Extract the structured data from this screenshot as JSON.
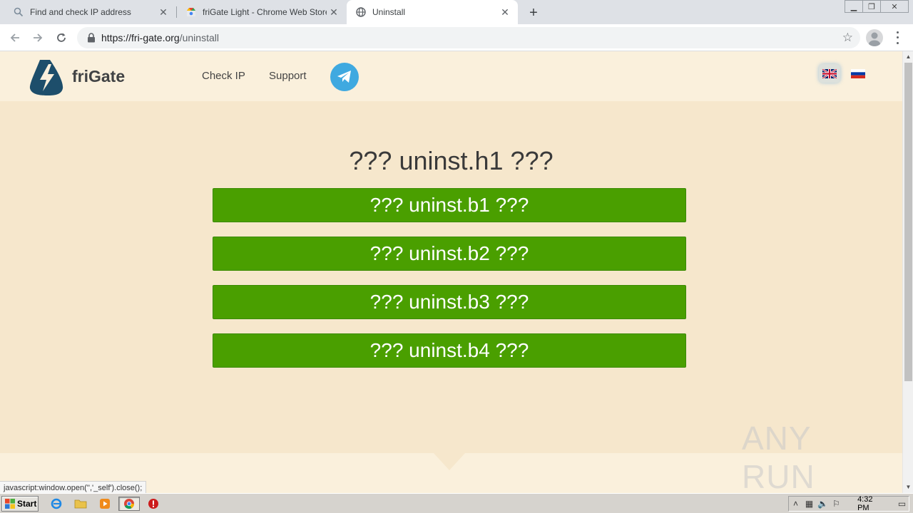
{
  "browser": {
    "tabs": [
      {
        "title": "Find and check IP address",
        "icon": "search-icon",
        "active": false
      },
      {
        "title": "friGate Light - Chrome Web Store",
        "icon": "webstore-icon",
        "active": false
      },
      {
        "title": "Uninstall",
        "icon": "globe-icon",
        "active": true
      }
    ],
    "new_tab": "+",
    "url_host": "https://fri-gate.org",
    "url_path": "/uninstall"
  },
  "site": {
    "brand": "friGate",
    "nav": [
      "Check IP",
      "Support"
    ],
    "languages": [
      "en",
      "ru"
    ],
    "heading": "??? uninst.h1 ???",
    "buttons": [
      "??? uninst.b1 ???",
      "??? uninst.b2 ???",
      "??? uninst.b3 ???",
      "??? uninst.b4 ???"
    ],
    "colors": {
      "accent": "#4a9f00",
      "background": "#f6e7cc",
      "header": "#faf0dc",
      "telegram": "#3fa9e0"
    }
  },
  "status_bar": "javascript:window.open('','_self').close();",
  "watermark": "ANY RUN",
  "taskbar": {
    "start": "Start",
    "clock": "4:32 PM"
  }
}
